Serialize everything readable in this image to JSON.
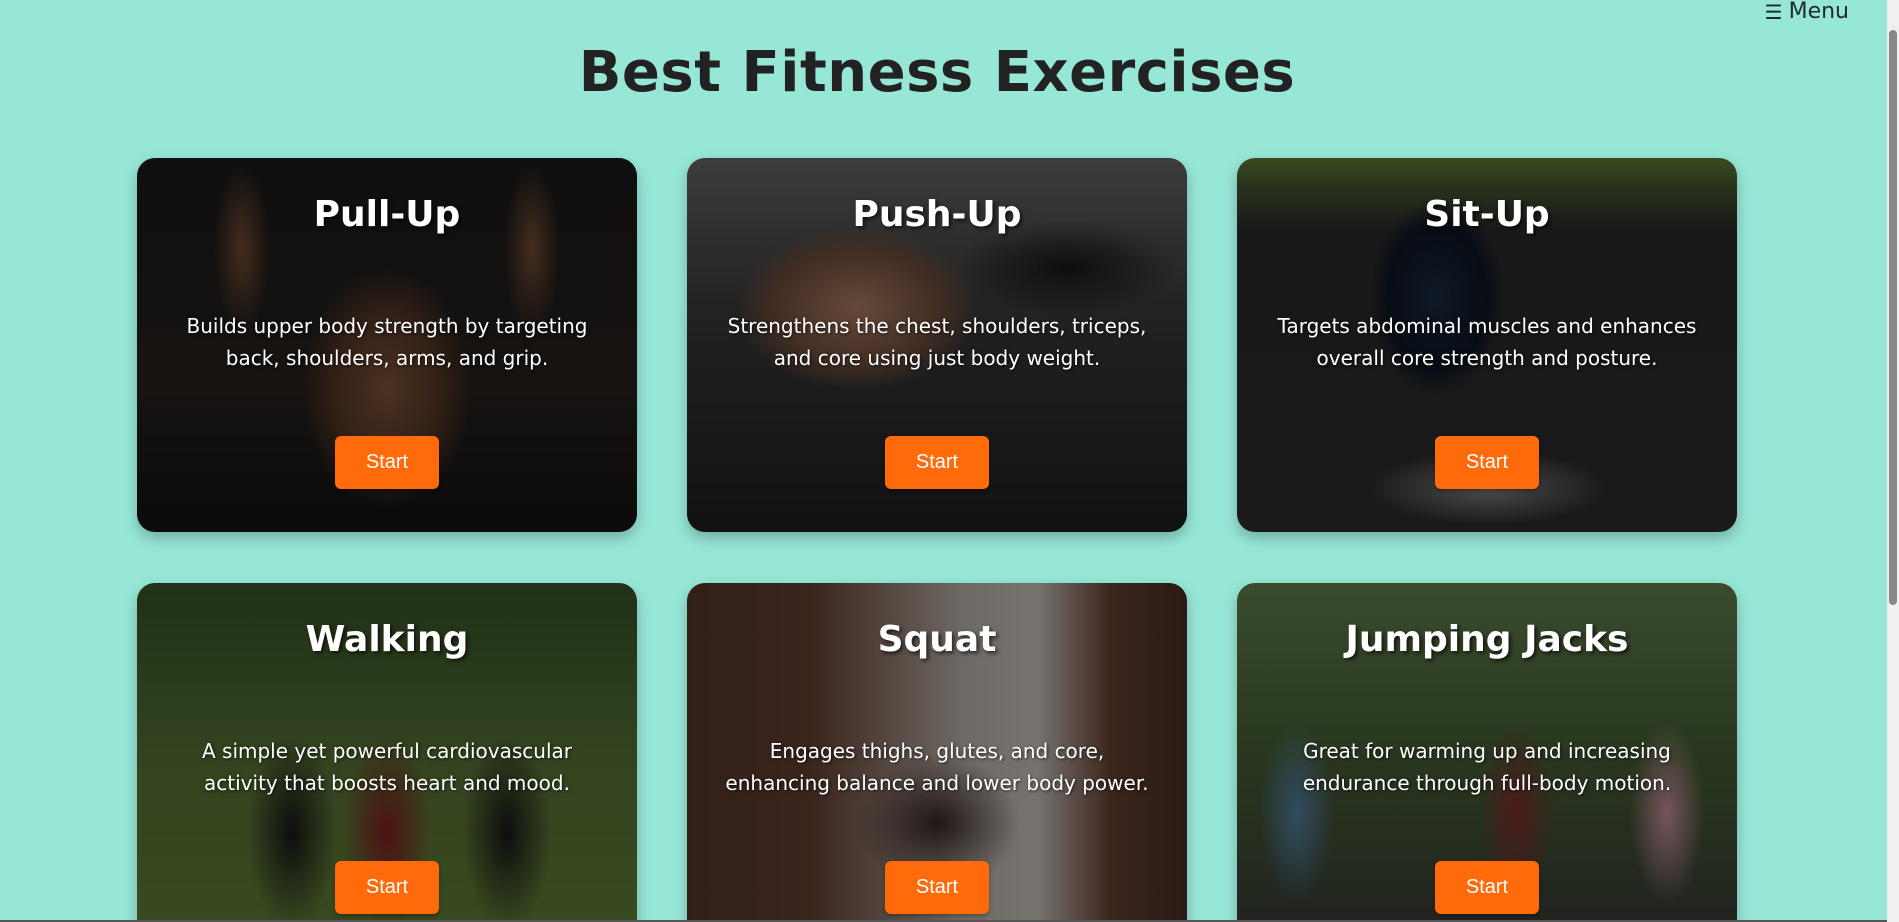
{
  "menu": {
    "icon": "hamburger-icon",
    "label": "Menu"
  },
  "page": {
    "title": "Best Fitness Exercises"
  },
  "cards": [
    {
      "title": "Pull-Up",
      "description": "Builds upper body strength by targeting back, shoulders, arms, and grip.",
      "button": "Start"
    },
    {
      "title": "Push-Up",
      "description": "Strengthens the chest, shoulders, triceps, and core using just body weight.",
      "button": "Start"
    },
    {
      "title": "Sit-Up",
      "description": "Targets abdominal muscles and enhances overall core strength and posture.",
      "button": "Start"
    },
    {
      "title": "Walking",
      "description": "A simple yet powerful cardiovascular activity that boosts heart and mood.",
      "button": "Start"
    },
    {
      "title": "Squat",
      "description": "Engages thighs, glutes, and core, enhancing balance and lower body power.",
      "button": "Start"
    },
    {
      "title": "Jumping Jacks",
      "description": "Great for warming up and increasing endurance through full-body motion.",
      "button": "Start"
    }
  ],
  "colors": {
    "background": "#97e7d7",
    "button": "#ff6a0a",
    "title": "#222222"
  }
}
